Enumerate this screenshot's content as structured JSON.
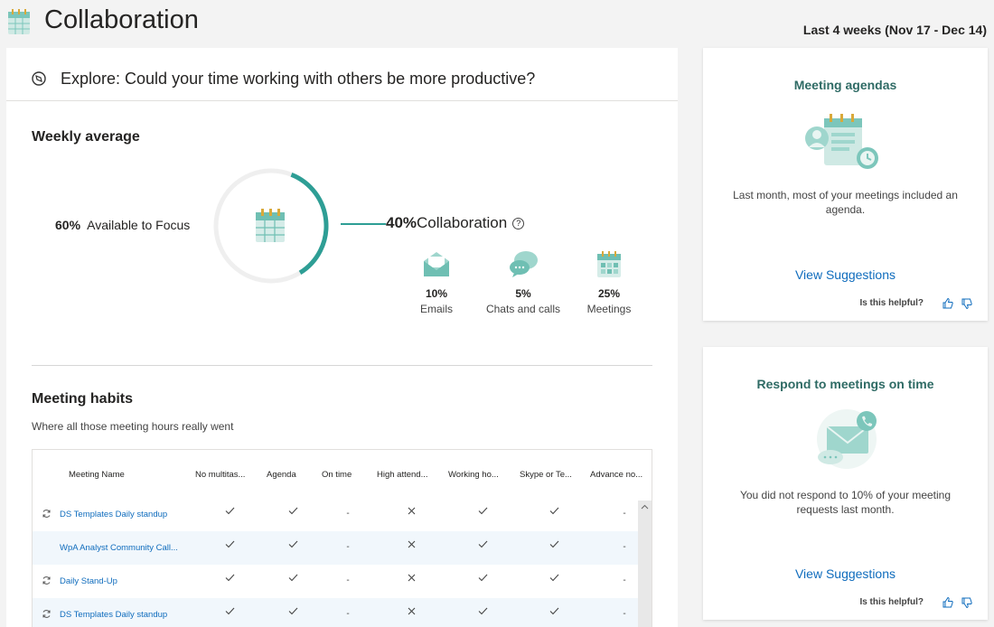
{
  "header": {
    "title": "Collaboration",
    "date_range": "Last 4 weeks (Nov 17 - Dec 14)"
  },
  "explore": {
    "text": "Explore: Could your time working with others be more productive?",
    "icon": "compass-icon"
  },
  "weekly": {
    "title": "Weekly average",
    "focus_pct": "60%",
    "focus_label": "Available to Focus",
    "collab_pct": "40%",
    "collab_label": "Collaboration",
    "help_icon": "?",
    "collab_fraction": 0.4,
    "accent_color": "#2e9e95",
    "breakdown": [
      {
        "pct": "10%",
        "label": "Emails",
        "icon": "envelope-icon"
      },
      {
        "pct": "5%",
        "label": "Chats and calls",
        "icon": "chat-bubbles-icon"
      },
      {
        "pct": "25%",
        "label": "Meetings",
        "icon": "calendar-icon"
      }
    ]
  },
  "habits": {
    "title": "Meeting habits",
    "subtitle": "Where all those meeting hours really went",
    "columns": [
      "Meeting Name",
      "No multitas...",
      "Agenda",
      "On time",
      "High attend...",
      "Working ho...",
      "Skype or Te...",
      "Advance no..."
    ],
    "rows": [
      {
        "name": "DS Templates Daily standup",
        "recurring": true,
        "cells": [
          "check",
          "check",
          "dash",
          "cross",
          "check",
          "check",
          "dash"
        ]
      },
      {
        "name": "WpA Analyst Community Call...",
        "recurring": false,
        "cells": [
          "check",
          "check",
          "dash",
          "cross",
          "check",
          "check",
          "dash"
        ]
      },
      {
        "name": "Daily Stand-Up",
        "recurring": true,
        "cells": [
          "check",
          "check",
          "dash",
          "cross",
          "check",
          "check",
          "dash"
        ]
      },
      {
        "name": "DS Templates Daily standup",
        "recurring": true,
        "cells": [
          "check",
          "check",
          "dash",
          "cross",
          "check",
          "check",
          "dash"
        ]
      }
    ]
  },
  "cards": [
    {
      "title": "Meeting agendas",
      "text": "Last month, most of your meetings included an agenda.",
      "link": "View Suggestions",
      "helpful": "Is this helpful?",
      "art": "agenda-illustration-icon"
    },
    {
      "title": "Respond to meetings on time",
      "text": "You did not respond to 10% of your meeting requests last month.",
      "link": "View Suggestions",
      "helpful": "Is this helpful?",
      "art": "respond-illustration-icon"
    }
  ],
  "symbols": {
    "dash": "-"
  }
}
